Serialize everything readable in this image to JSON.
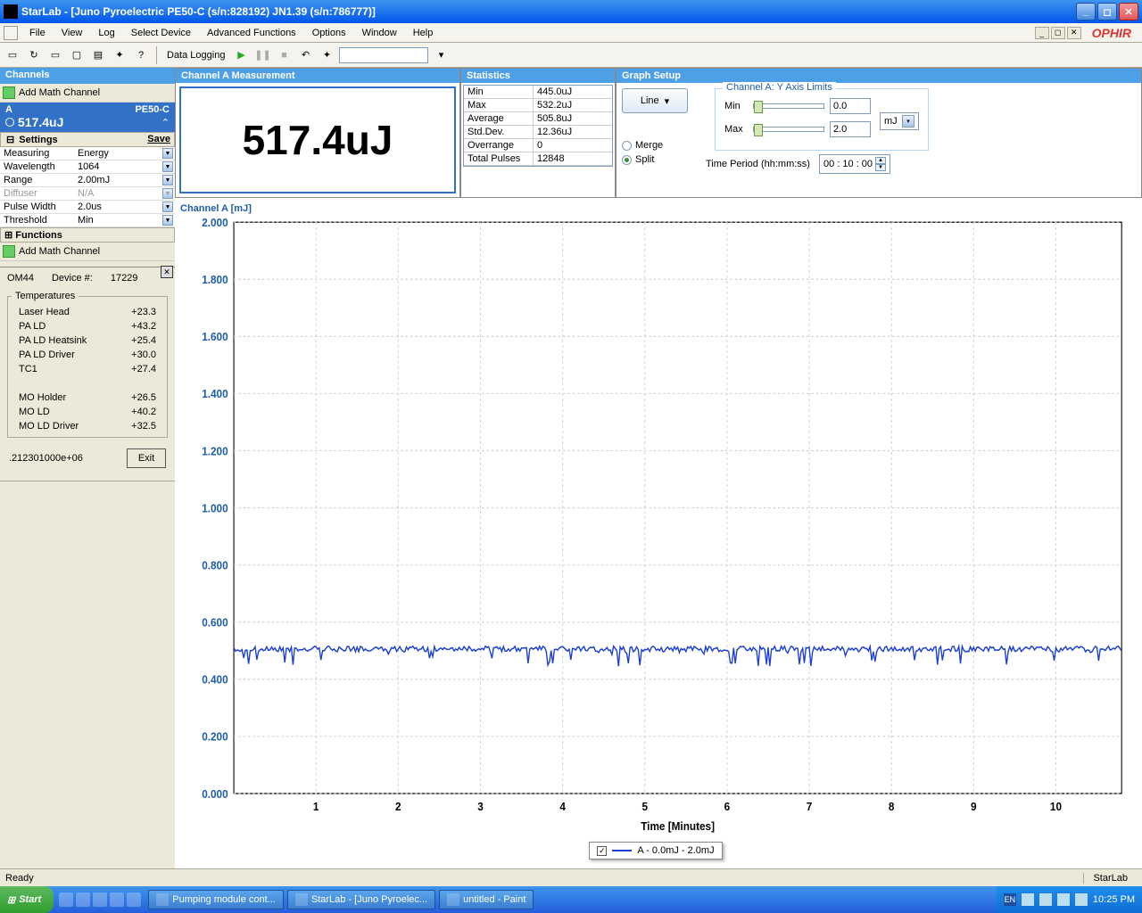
{
  "window": {
    "title": "StarLab - [Juno Pyroelectric PE50-C (s/n:828192)  JN1.39 (s/n:786777)]"
  },
  "menu": {
    "file": "File",
    "view": "View",
    "log": "Log",
    "selectDevice": "Select Device",
    "advFunc": "Advanced Functions",
    "options": "Options",
    "window": "Window",
    "help": "Help"
  },
  "toolbar": {
    "dataLogging": "Data Logging"
  },
  "logo": "OPHIR",
  "channels": {
    "header": "Channels",
    "addMath": "Add Math Channel",
    "chan": {
      "name": "A",
      "device": "PE50-C",
      "value": "517.4uJ"
    },
    "settings": {
      "header": "Settings",
      "save": "Save",
      "rows": [
        {
          "lab": "Measuring",
          "val": "Energy"
        },
        {
          "lab": "Wavelength",
          "val": "1064"
        },
        {
          "lab": "Range",
          "val": "2.00mJ"
        },
        {
          "lab": "Diffuser",
          "val": "N/A",
          "dis": true
        },
        {
          "lab": "Pulse Width",
          "val": "2.0us"
        },
        {
          "lab": "Threshold",
          "val": "Min"
        }
      ]
    },
    "functions": "Functions",
    "addMath2": "Add Math Channel"
  },
  "device": {
    "port": "OM44",
    "devlabel": "Device #:",
    "devnum": "17229",
    "tempsHeader": "Temperatures",
    "temps": [
      {
        "n": "Laser Head",
        "v": "+23.3"
      },
      {
        "n": "PA LD",
        "v": "+43.2"
      },
      {
        "n": "PA LD Heatsink",
        "v": "+25.4"
      },
      {
        "n": "PA LD Driver",
        "v": "+30.0"
      },
      {
        "n": "TC1",
        "v": "+27.4"
      }
    ],
    "temps2": [
      {
        "n": "MO Holder",
        "v": "+26.5"
      },
      {
        "n": "MO LD",
        "v": "+40.2"
      },
      {
        "n": "MO LD Driver",
        "v": "+32.5"
      }
    ],
    "counter": ".212301000e+06",
    "exit": "Exit"
  },
  "measure": {
    "header": "Channel A Measurement",
    "value": "517.4uJ"
  },
  "stats": {
    "header": "Statistics",
    "rows": [
      {
        "l": "Min",
        "v": "445.0uJ"
      },
      {
        "l": "Max",
        "v": "532.2uJ"
      },
      {
        "l": "Average",
        "v": "505.8uJ"
      },
      {
        "l": "Std.Dev.",
        "v": "12.36uJ"
      },
      {
        "l": "Overrange",
        "v": "0"
      },
      {
        "l": "Total Pulses",
        "v": "12848"
      }
    ]
  },
  "graph": {
    "header": "Graph Setup",
    "lineBtn": "Line",
    "merge": "Merge",
    "split": "Split",
    "yaxisLegend": "Channel A: Y Axis Limits",
    "min": "Min",
    "max": "Max",
    "minV": "0.0",
    "maxV": "2.0",
    "unit": "mJ",
    "tpLabel": "Time Period (hh:mm:ss)",
    "tpVal": "00 : 10 : 00"
  },
  "chart": {
    "title": "Channel A [mJ]",
    "xlabel": "Time [Minutes]",
    "legend": "A - 0.0mJ - 2.0mJ"
  },
  "status": {
    "ready": "Ready",
    "app": "StarLab"
  },
  "taskbar": {
    "start": "Start",
    "items": [
      {
        "t": "Pumping module cont..."
      },
      {
        "t": "StarLab - [Juno Pyroelec..."
      },
      {
        "t": "untitled - Paint"
      }
    ],
    "lang": "EN",
    "time": "10:25 PM"
  },
  "chart_data": {
    "type": "line",
    "title": "Channel A [mJ]",
    "xlabel": "Time [Minutes]",
    "ylabel": "",
    "xlim": [
      0,
      10.8
    ],
    "ylim": [
      0,
      2.0
    ],
    "yticks": [
      0.0,
      0.2,
      0.4,
      0.6,
      0.8,
      1.0,
      1.2,
      1.4,
      1.6,
      1.8,
      2.0
    ],
    "xticks": [
      1,
      2,
      3,
      4,
      5,
      6,
      7,
      8,
      9,
      10
    ],
    "series": [
      {
        "name": "A - 0.0mJ - 2.0mJ",
        "mean": 0.506,
        "min": 0.445,
        "max": 0.532,
        "note": "noisy flat line around ~0.50-0.52 mJ across entire 0-10.8 min range with occasional downward spikes to ~0.44"
      }
    ]
  }
}
